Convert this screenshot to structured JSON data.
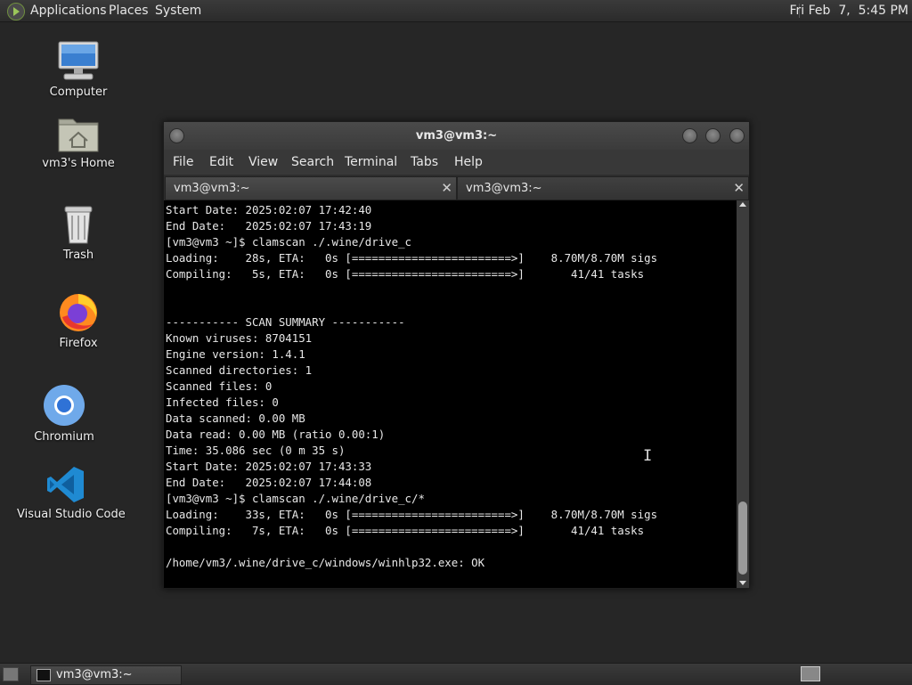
{
  "top_panel": {
    "menus": [
      "Applications",
      "Places",
      "System"
    ],
    "clock": "Fri Feb  7,  5:45 PM"
  },
  "desktop": {
    "icons": [
      {
        "label": "Computer",
        "icon": "computer-icon"
      },
      {
        "label": "vm3's Home",
        "icon": "home-folder-icon"
      },
      {
        "label": "Trash",
        "icon": "trash-icon"
      },
      {
        "label": "Firefox",
        "icon": "firefox-icon"
      },
      {
        "label": "Chromium",
        "icon": "chromium-icon"
      },
      {
        "label": "Visual Studio Code",
        "icon": "vscode-icon"
      }
    ]
  },
  "window": {
    "title": "vm3@vm3:~",
    "menus": [
      "File",
      "Edit",
      "View",
      "Search",
      "Terminal",
      "Tabs",
      "Help"
    ],
    "tabs": [
      {
        "label": "vm3@vm3:~",
        "active": true
      },
      {
        "label": "vm3@vm3:~",
        "active": false
      }
    ],
    "terminal_lines": [
      "Start Date: 2025:02:07 17:42:40",
      "End Date:   2025:02:07 17:43:19",
      "[vm3@vm3 ~]$ clamscan ./.wine/drive_c",
      "Loading:    28s, ETA:   0s [========================>]    8.70M/8.70M sigs",
      "Compiling:   5s, ETA:   0s [========================>]       41/41 tasks",
      "",
      "",
      "----------- SCAN SUMMARY -----------",
      "Known viruses: 8704151",
      "Engine version: 1.4.1",
      "Scanned directories: 1",
      "Scanned files: 0",
      "Infected files: 0",
      "Data scanned: 0.00 MB",
      "Data read: 0.00 MB (ratio 0.00:1)",
      "Time: 35.086 sec (0 m 35 s)",
      "Start Date: 2025:02:07 17:43:33",
      "End Date:   2025:02:07 17:44:08",
      "[vm3@vm3 ~]$ clamscan ./.wine/drive_c/*",
      "Loading:    33s, ETA:   0s [========================>]    8.70M/8.70M sigs",
      "Compiling:   7s, ETA:   0s [========================>]       41/41 tasks",
      "",
      "/home/vm3/.wine/drive_c/windows/winhlp32.exe: OK"
    ]
  },
  "bottom_panel": {
    "task_label": "vm3@vm3:~"
  }
}
